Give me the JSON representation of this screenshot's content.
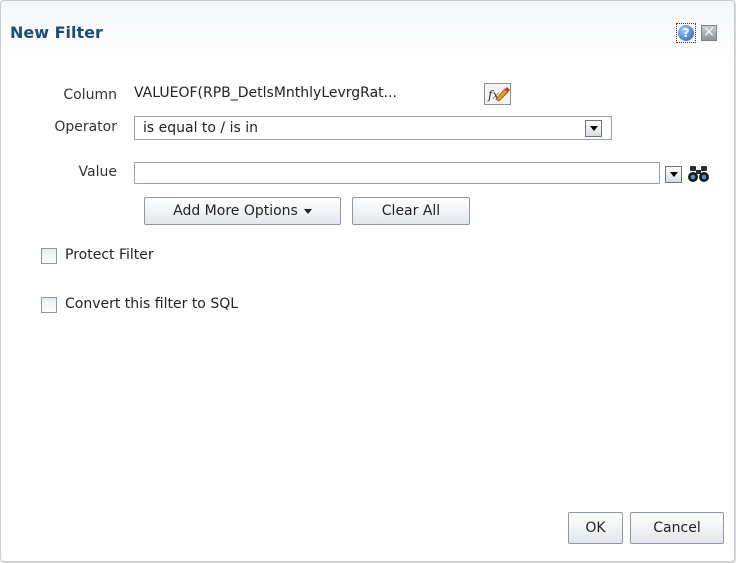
{
  "dialog": {
    "title": "New Filter",
    "help_glyph": "?",
    "close_glyph": "×"
  },
  "form": {
    "column_label": "Column",
    "column_value": "VALUEOF(RPB_DetlsMnthlyLevrgRat...",
    "operator_label": "Operator",
    "operator_value": "is equal to / is in",
    "value_label": "Value",
    "value_text": ""
  },
  "buttons": {
    "add_more_options": "Add More Options",
    "clear_all": "Clear All",
    "ok": "OK",
    "cancel": "Cancel"
  },
  "options": {
    "protect_filter": "Protect Filter",
    "convert_to_sql": "Convert this filter to SQL",
    "protect_filter_checked": false,
    "convert_to_sql_checked": false
  },
  "icons": {
    "help": "help-icon",
    "close": "close-icon",
    "formula": "edit-formula-icon",
    "search_values": "binoculars-icon",
    "dropdown": "chevron-down-icon"
  },
  "colors": {
    "title": "#1a4d7a",
    "help_blue": "#1f5fb8"
  }
}
